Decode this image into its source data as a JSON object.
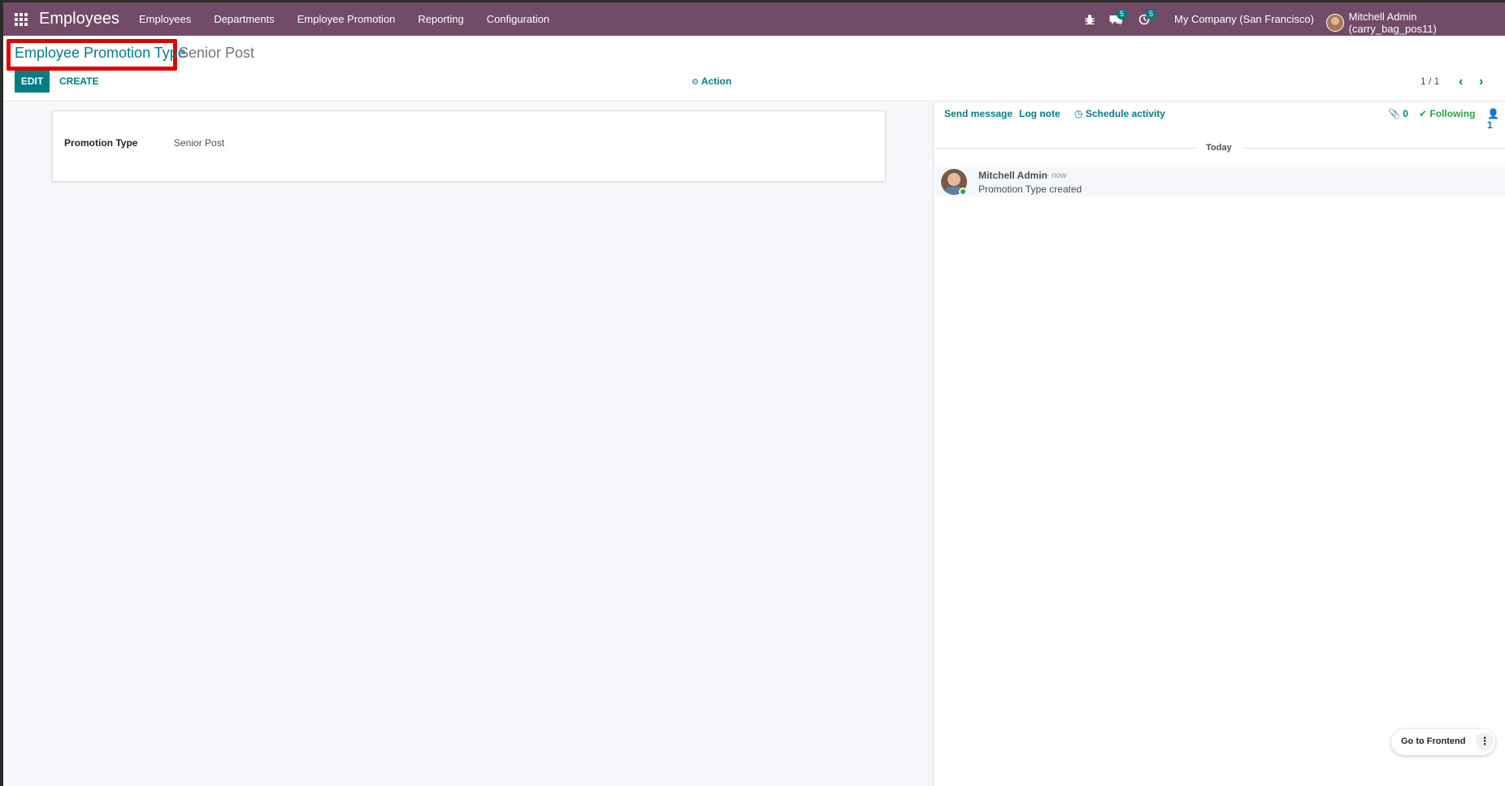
{
  "navbar": {
    "app_title": "Employees",
    "menu": [
      "Employees",
      "Departments",
      "Employee Promotion",
      "Reporting",
      "Configuration"
    ],
    "messages_badge": "5",
    "activities_badge": "5",
    "company": "My Company (San Francisco)",
    "user": "Mitchell Admin (carry_bag_pos11)"
  },
  "control": {
    "breadcrumb_parent": "Employee Promotion Type",
    "breadcrumb_current": "Senior Post",
    "edit_label": "EDIT",
    "create_label": "CREATE",
    "action_label": "Action",
    "pager": "1 / 1"
  },
  "form": {
    "field_label": "Promotion Type",
    "field_value": "Senior Post"
  },
  "chatter": {
    "send_message": "Send message",
    "log_note": "Log note",
    "schedule_activity": "Schedule activity",
    "attachments_count": "0",
    "following_label": "Following",
    "followers_count": "1",
    "date_separator": "Today",
    "messages": [
      {
        "author": "Mitchell Admin",
        "time": "- now",
        "body": "Promotion Type created"
      }
    ]
  },
  "frontend": {
    "label": "Go to Frontend"
  },
  "colors": {
    "navbar": "#714B67",
    "accent": "#017E84",
    "following": "#28a745",
    "highlight": "#e00000"
  }
}
